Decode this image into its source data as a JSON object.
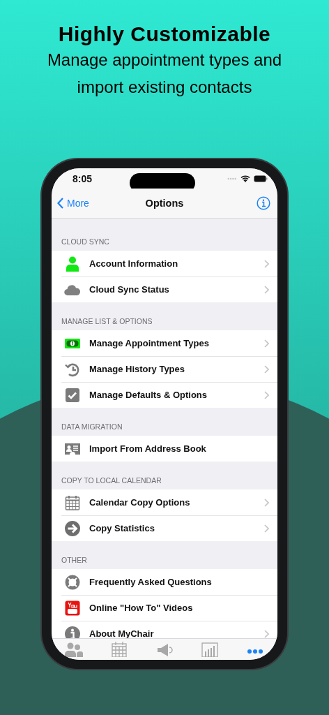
{
  "headline": {
    "title": "Highly Customizable",
    "subtitle": "Manage appointment types and import existing contacts"
  },
  "status_bar": {
    "time": "8:05"
  },
  "nav": {
    "back": "More",
    "title": "Options"
  },
  "sections": [
    {
      "header": "CLOUD SYNC",
      "items": [
        {
          "label": "Account Information",
          "kind": "person",
          "chevron": true
        },
        {
          "label": "Cloud Sync Status",
          "kind": "cloud",
          "chevron": true
        }
      ]
    },
    {
      "header": "MANAGE LIST & OPTIONS",
      "items": [
        {
          "label": "Manage Appointment Types",
          "kind": "money",
          "chevron": true
        },
        {
          "label": "Manage History Types",
          "kind": "history",
          "chevron": true
        },
        {
          "label": "Manage Defaults & Options",
          "kind": "check",
          "chevron": true
        }
      ]
    },
    {
      "header": "DATA MIGRATION",
      "items": [
        {
          "label": "Import From Address Book",
          "kind": "card",
          "chevron": false
        }
      ]
    },
    {
      "header": "COPY TO LOCAL CALENDAR",
      "items": [
        {
          "label": "Calendar Copy Options",
          "kind": "calendar",
          "chevron": true
        },
        {
          "label": "Copy Statistics",
          "kind": "arrow",
          "chevron": true
        }
      ]
    },
    {
      "header": "OTHER",
      "items": [
        {
          "label": "Frequently Asked Questions",
          "kind": "lifebuoy",
          "chevron": false
        },
        {
          "label": "Online \"How To\" Videos",
          "kind": "video",
          "chevron": false
        },
        {
          "label": "About MyChair",
          "kind": "info",
          "chevron": true
        }
      ]
    }
  ],
  "tabs": [
    {
      "kind": "people",
      "selected": false
    },
    {
      "kind": "calendar",
      "selected": false
    },
    {
      "kind": "megaphone",
      "selected": false
    },
    {
      "kind": "chart",
      "selected": false
    },
    {
      "kind": "more",
      "selected": true
    }
  ]
}
